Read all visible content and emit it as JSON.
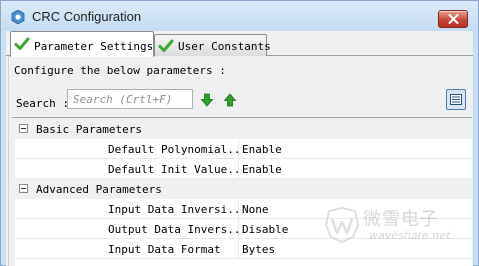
{
  "window": {
    "title": "CRC Configuration"
  },
  "tabs": [
    {
      "label": "Parameter Settings",
      "active": true
    },
    {
      "label": "User Constants",
      "active": false
    }
  ],
  "panel": {
    "description": "Configure the below parameters :",
    "search_label": "Search :",
    "search_placeholder": "Search (Crtl+F)",
    "search_value": ""
  },
  "groups": [
    {
      "name": "Basic Parameters",
      "params": [
        {
          "name": "Default Polynomial...",
          "value": "Enable"
        },
        {
          "name": "Default Init Value...",
          "value": "Enable"
        }
      ]
    },
    {
      "name": "Advanced Parameters",
      "params": [
        {
          "name": "Input Data Inversi...",
          "value": "None"
        },
        {
          "name": "Output Data Invers...",
          "value": "Disable"
        },
        {
          "name": "Input Data Format",
          "value": "Bytes"
        }
      ]
    }
  ],
  "watermark": {
    "cn": "微雪电子",
    "url": "waveshare.net"
  },
  "colors": {
    "titlebar": "#c6dcf2",
    "close_button": "#c7463a",
    "check_green": "#3aa832",
    "arrow_green": "#2fa12a",
    "panel_bg": "#f0f0f0"
  },
  "icons": {
    "app": "gear-icon",
    "tab_status": "check-icon",
    "find_next": "arrow-down-icon",
    "find_prev": "arrow-up-icon",
    "view_toggle": "list-view-icon"
  }
}
